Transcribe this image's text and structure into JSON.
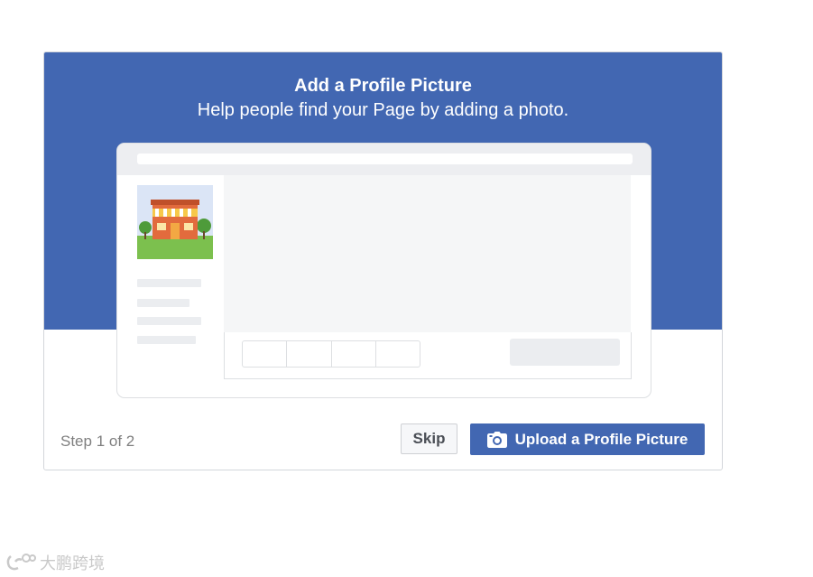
{
  "dialog": {
    "title": "Add a Profile Picture",
    "subtitle": "Help people find your Page by adding a photo.",
    "step_text": "Step 1 of 2",
    "skip_label": "Skip",
    "upload_label": "Upload a Profile Picture",
    "upload_icon": "camera-icon"
  },
  "watermark": {
    "text": "大鹏跨境",
    "icon": "watermark-logo-icon"
  },
  "colors": {
    "brand_blue": "#4267b2",
    "placeholder_gray": "#ebedf0"
  }
}
